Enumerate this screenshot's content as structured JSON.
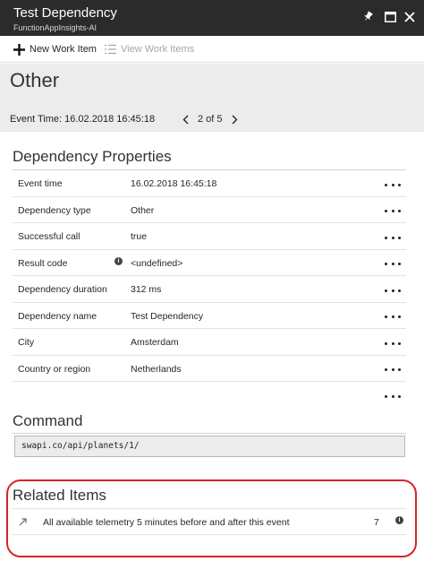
{
  "window": {
    "title": "Test Dependency",
    "subtitle": "FunctionAppInsights-AI"
  },
  "toolbar": {
    "new_work_item": "New Work Item",
    "view_work_items": "View Work Items"
  },
  "header": {
    "type": "Other",
    "event_time": "Event Time: 16.02.2018 16:45:18",
    "pager": "2 of 5"
  },
  "properties": {
    "title": "Dependency Properties",
    "rows": [
      {
        "name": "Event time",
        "value": "16.02.2018 16:45:18"
      },
      {
        "name": "Dependency type",
        "value": "Other"
      },
      {
        "name": "Successful call",
        "value": "true"
      },
      {
        "name": "Result code",
        "value": "<undefined>"
      },
      {
        "name": "Dependency duration",
        "value": "312 ms"
      },
      {
        "name": "Dependency name",
        "value": "Test Dependency"
      },
      {
        "name": "City",
        "value": "Amsterdam"
      },
      {
        "name": "Country or region",
        "value": "Netherlands"
      }
    ]
  },
  "command": {
    "title": "Command",
    "text": "swapi.co/api/planets/1/"
  },
  "related": {
    "title": "Related Items",
    "item_label": "All available telemetry 5 minutes before and after this event",
    "item_count": "7"
  },
  "colors": {
    "titlebar": "#2b2b2b",
    "header_bg": "#ececec",
    "highlight": "#d7232a"
  }
}
